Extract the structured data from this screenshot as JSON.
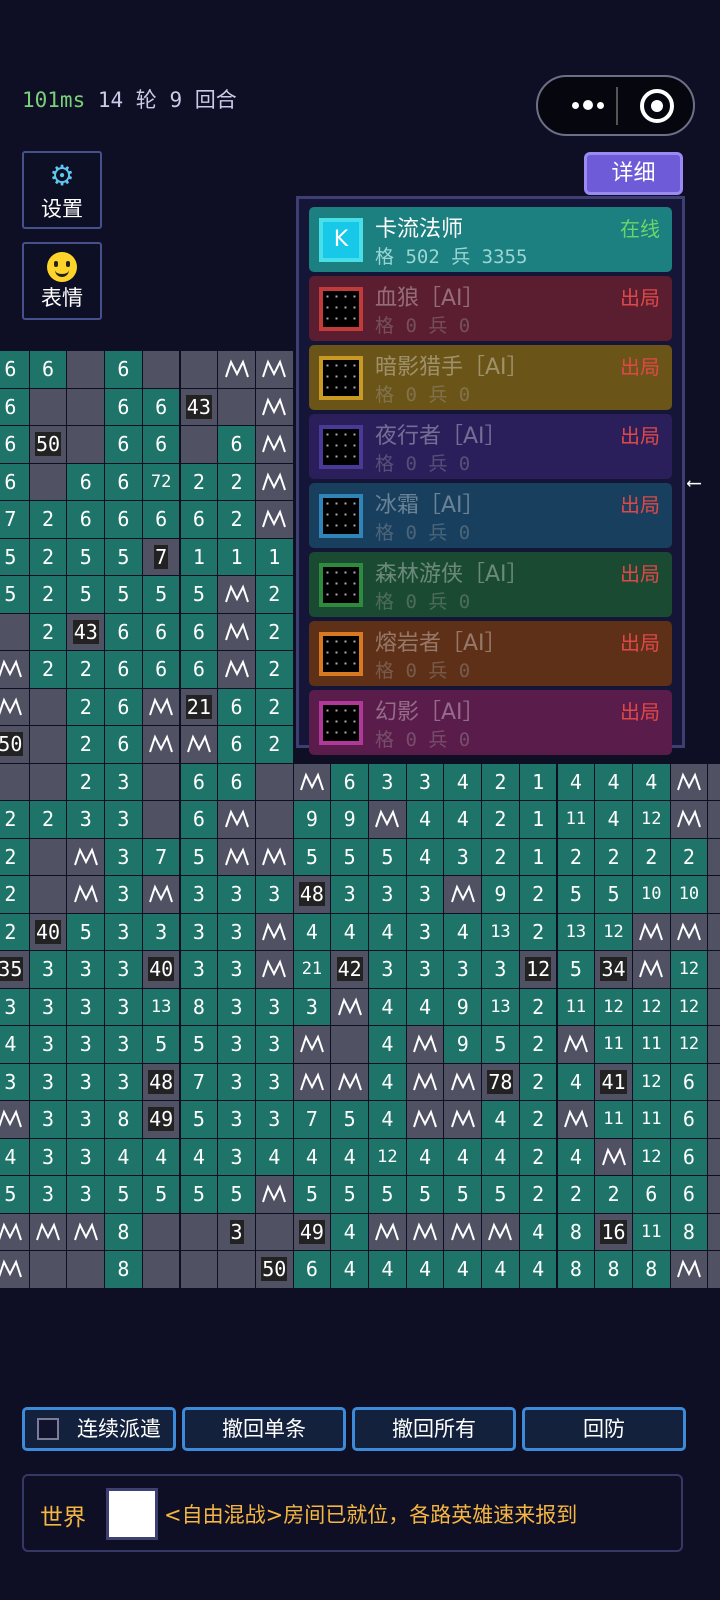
{
  "status": {
    "ping": "101ms",
    "info": "14 轮 9 回合"
  },
  "capsule": {
    "more_icon": "more-dots-icon",
    "record_icon": "record-icon"
  },
  "side": {
    "settings": {
      "label": "设置",
      "icon": "gear-icon"
    },
    "emoji": {
      "label": "表情",
      "icon": "smiley-icon"
    }
  },
  "detail_label": "详细",
  "players": [
    {
      "name": "卡流法师",
      "status": "在线",
      "score": "格 502  兵 3355",
      "avatar_letter": "K",
      "color": "#1c7f80",
      "border": "#48e0e8",
      "status_color": "#6ad66a",
      "active": true
    },
    {
      "name": "血狼［AI］",
      "status": "出局",
      "score": "格 0  兵 0",
      "color": "#5a1e30",
      "border": "#c23a3a",
      "status_color": "#e04848"
    },
    {
      "name": "暗影猎手［AI］",
      "status": "出局",
      "score": "格 0  兵 0",
      "color": "#6a5418",
      "border": "#c89a24",
      "status_color": "#e04848"
    },
    {
      "name": "夜行者［AI］",
      "status": "出局",
      "score": "格 0  兵 0",
      "color": "#2a1f5a",
      "border": "#4a3a98",
      "status_color": "#e04848"
    },
    {
      "name": "冰霜［AI］",
      "status": "出局",
      "score": "格 0  兵 0",
      "color": "#193f5e",
      "border": "#2f84b8",
      "status_color": "#e04848"
    },
    {
      "name": "森林游侠［AI］",
      "status": "出局",
      "score": "格 0  兵 0",
      "color": "#1b4a32",
      "border": "#2e8a3c",
      "status_color": "#e04848"
    },
    {
      "name": "熔岩者［AI］",
      "status": "出局",
      "score": "格 0  兵 0",
      "color": "#5e3018",
      "border": "#d87820",
      "status_color": "#e04848"
    },
    {
      "name": "幻影［AI］",
      "status": "出局",
      "score": "格 0  兵 0",
      "color": "#5a1c4a",
      "border": "#b03898",
      "status_color": "#e04848"
    }
  ],
  "grid_rows": [
    "6,6,d,6,d,d,m,m",
    "6,d,d,6,6,t43,d,m",
    "6,t50,d,6,6,d,6,m",
    "6,d,6,6,72,2,2,m",
    "7,2,6,6,6,6,2,m",
    "5,2,5,5,t7,1,1,1",
    "5,2,5,5,5,5,m,2",
    "d,2,t43,6,6,6,m,2",
    "m,2,2,6,6,6,m,2",
    "m,d,2,6,m,t21,6,2",
    "t50,d,2,6,m,m,6,2",
    "d,d,2,3,d,6,6,d,m,6,3,3,4,2,1,4,4,4,m,d",
    "2,2,3,3,d,6,m,d,9,9,m,4,4,2,1,11,4,12,m,d",
    "2,d,m,3,7,5,m,m,5,5,5,4,3,2,1,2,2,2,2,d",
    "2,d,m,3,m,3,3,3,t48,3,3,3,m,9,2,5,5,10,10,d",
    "2,t40,5,3,3,3,3,m,4,4,4,3,4,13,2,13,12,m,m,d",
    "t35,3,3,3,t40,3,3,m,21,t42,3,3,3,3,t12,5,t34,m,12,d",
    "3,3,3,3,13,8,3,3,3,m,4,4,9,13,2,11,12,12,12,d",
    "4,3,3,3,5,5,3,3,m,d,4,m,9,5,2,m,11,11,12,d",
    "3,3,3,3,t48,7,3,3,m,m,4,m,m,t78,2,4,t41,12,6,d",
    "m,3,3,8,t49,5,3,3,7,5,4,m,m,4,2,m,11,11,6,d",
    "4,3,3,4,4,4,3,4,4,4,12,4,4,4,2,4,m,12,6,d",
    "5,3,3,5,5,5,5,m,5,5,5,5,5,5,2,2,2,6,6,d",
    "m,m,m,8,d,d,t3,d,t49,4,m,m,m,m,4,8,t16,11,8,d",
    "m,d,d,8,d,d,d,t50,6,4,4,4,4,4,4,8,8,8,m,d"
  ],
  "bottom": {
    "continuous": "连续派遣",
    "undo_one": "撤回单条",
    "undo_all": "撤回所有",
    "defend": "回防"
  },
  "chat": {
    "channel": "世界",
    "message": "<自由混战>房间已就位，各路英雄速来报到"
  }
}
